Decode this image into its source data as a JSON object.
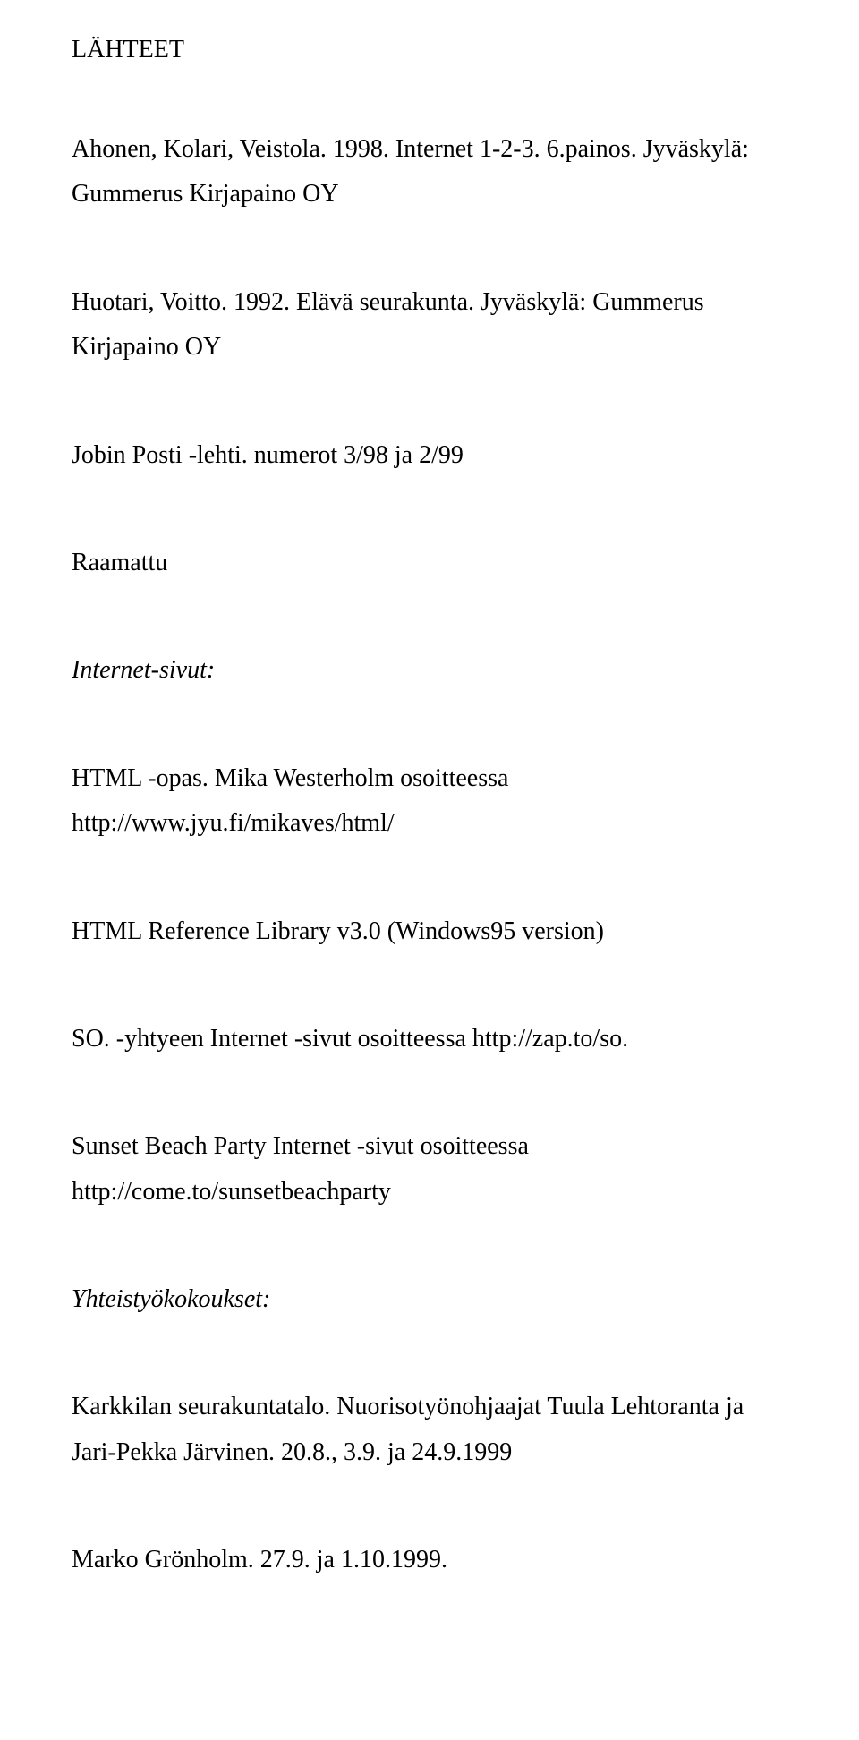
{
  "heading": "LÄHTEET",
  "entries": [
    {
      "text": "Ahonen, Kolari, Veistola. 1998. Internet 1-2-3. 6.painos. Jyväskylä: Gummerus Kirjapaino OY",
      "italic": false
    },
    {
      "text": "Huotari, Voitto. 1992. Elävä seurakunta. Jyväskylä: Gummerus Kirjapaino OY",
      "italic": false
    },
    {
      "text": "Jobin Posti -lehti. numerot 3/98 ja 2/99",
      "italic": false
    },
    {
      "text": "Raamattu",
      "italic": false
    },
    {
      "text": "Internet-sivut:",
      "italic": true
    },
    {
      "text": "HTML -opas. Mika Westerholm osoitteessa http://www.jyu.fi/mikaves/html/",
      "italic": false
    },
    {
      "text": "HTML Reference Library v3.0 (Windows95 version)",
      "italic": false
    },
    {
      "text": "SO. -yhtyeen Internet -sivut osoitteessa http://zap.to/so.",
      "italic": false
    },
    {
      "text": "Sunset Beach Party Internet -sivut osoitteessa http://come.to/sunsetbeachparty",
      "italic": false
    },
    {
      "text": "Yhteistyökokoukset:",
      "italic": true
    },
    {
      "text": "Karkkilan seurakuntatalo. Nuorisotyönohjaajat Tuula Lehtoranta ja Jari-Pekka Järvinen. 20.8., 3.9. ja 24.9.1999",
      "italic": false
    }
  ],
  "last_line": "Marko Grönholm. 27.9. ja 1.10.1999."
}
